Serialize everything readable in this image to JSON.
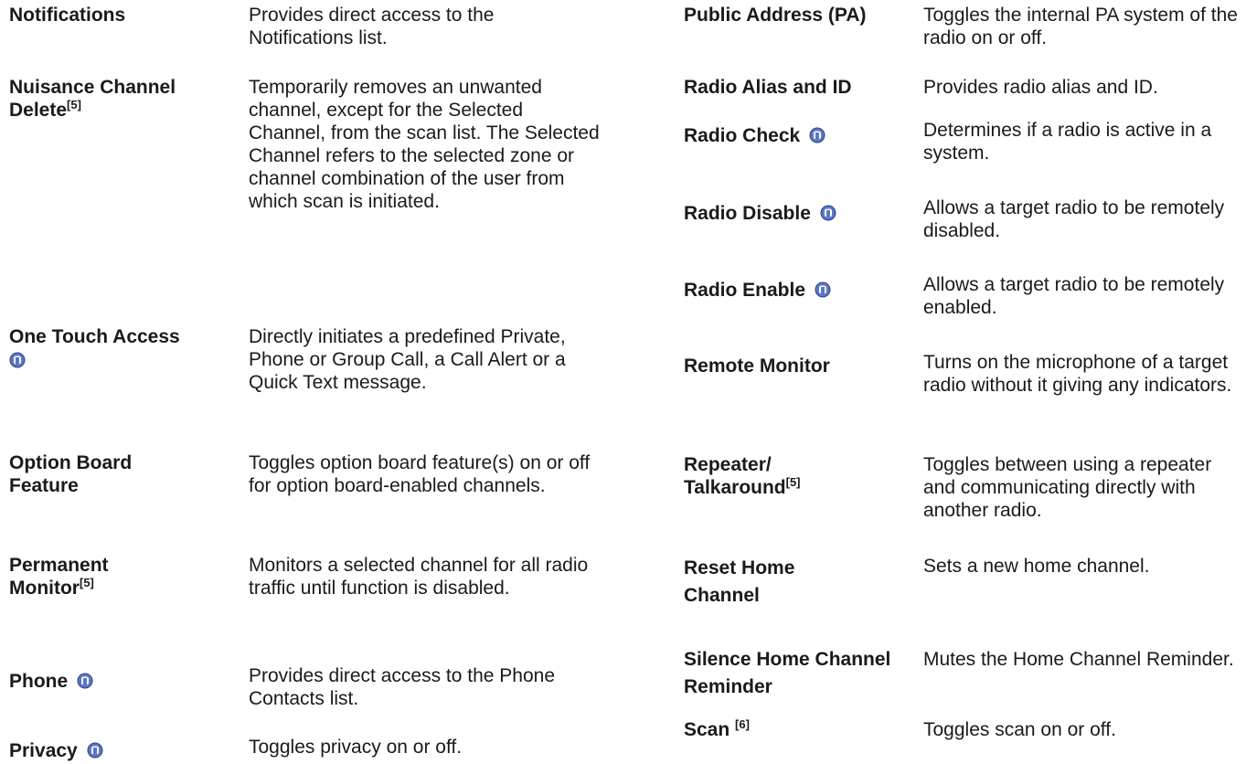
{
  "left": [
    {
      "term": "Notifications",
      "desc": "Provides direct access to the Notifications list."
    },
    {
      "term": "Nuisance Channel Delete",
      "sup": "[5]",
      "desc": "Temporarily removes an unwanted channel, except for the Selected Channel, from the scan list. The Selected Channel refers to the selected zone or channel combination of the user from which scan is initiated."
    },
    {
      "term": "One Touch Access",
      "icon": "digital-mode-icon",
      "desc": "Directly initiates a predefined Private, Phone or Group Call, a Call Alert or a Quick Text message."
    },
    {
      "term": "Option Board Feature",
      "desc": "Toggles option board feature(s) on or off for option board-enabled channels."
    },
    {
      "term": "Permanent Monitor",
      "sup": "[5]",
      "desc": "Monitors a selected channel for all radio traffic until function is disabled."
    },
    {
      "term": "Phone",
      "icon": "digital-mode-icon",
      "desc": "Provides direct access to the Phone Contacts list."
    },
    {
      "term": "Privacy",
      "icon": "digital-mode-icon",
      "desc": "Toggles privacy on or off."
    }
  ],
  "right": [
    {
      "term": "Public Address (PA)",
      "desc": "Toggles the internal PA system of the radio on or off."
    },
    {
      "term": "Radio Alias and ID",
      "desc": "Provides radio alias and ID."
    },
    {
      "term": "Radio Check",
      "icon": "digital-mode-icon",
      "desc": "Determines if a radio is active in a system."
    },
    {
      "term": "Radio Disable",
      "icon": "digital-mode-icon",
      "desc": "Allows a target radio to be remotely disabled."
    },
    {
      "term": "Radio Enable",
      "icon": "digital-mode-icon",
      "desc": "Allows a target radio to be remotely enabled."
    },
    {
      "term": "Remote Monitor",
      "desc": "Turns on the microphone of a target radio without it giving any indicators."
    },
    {
      "term": "Repeater/ Talkaround",
      "sup": "[5]",
      "desc": "Toggles between using a repeater and communicating directly with another radio."
    },
    {
      "term": "Reset Home Channel",
      "desc": "Sets a new home channel."
    },
    {
      "term": "Silence Home Channel Reminder",
      "desc": "Mutes the Home Channel Reminder."
    },
    {
      "term": "Scan",
      "sup": "[6]",
      "desc": "Toggles scan on or off."
    }
  ],
  "colors": {
    "text": "#1a1a1a",
    "icon_fill": "#5b78c4",
    "icon_dark": "#2e3f86"
  }
}
